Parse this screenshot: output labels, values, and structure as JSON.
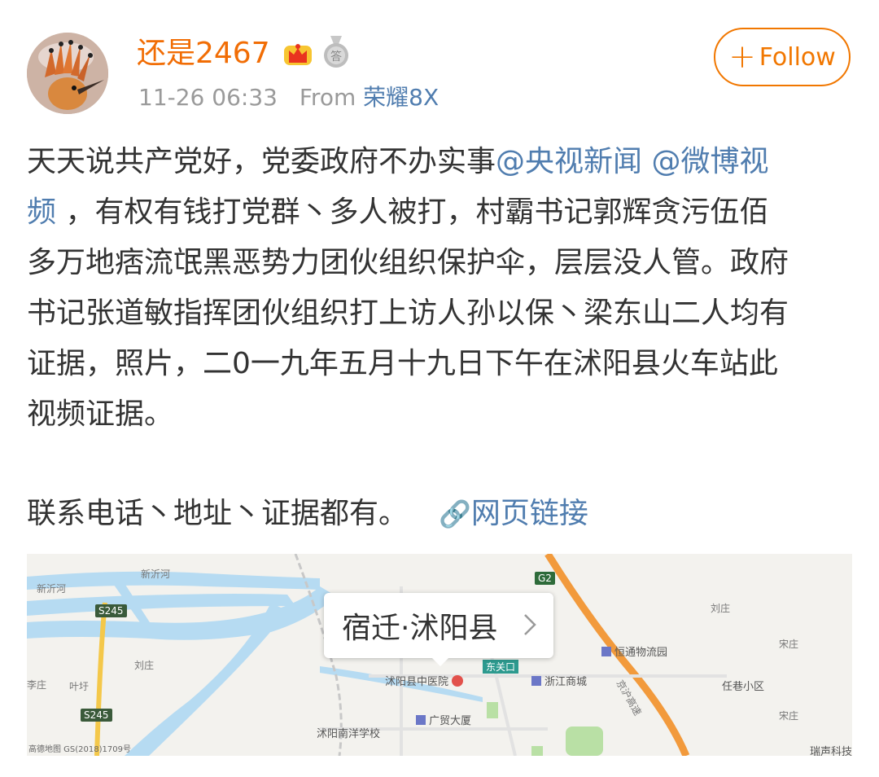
{
  "user": {
    "name": "还是2467",
    "timestamp": "11-26 06:33",
    "from_label": "From",
    "device": "荣耀8X"
  },
  "follow_button": {
    "plus": "+",
    "label": "Follow"
  },
  "post": {
    "text_part1": "天天说共产党好，党委政府不办实事",
    "mention1": "@央视新闻",
    "mention2_a": "@微博视",
    "mention2_b": "频",
    "text_line2": " ，有权有钱打党群丶多人被打，村霸书记郭辉贪污伍佰",
    "text_line3": "多万地痞流氓黑恶势力团伙组织保护伞，层层没人管。政府",
    "text_line4": "书记张道敏指挥团伙组织打上访人孙以保丶梁东山二人均有",
    "text_line5": "证据，照片，二0一九年五月十九日下午在沭阳县火车站此",
    "text_line6": "视频证据。",
    "contact_text": "联系电话丶地址丶证据都有。",
    "weblink_icon": "🔗",
    "weblink_label": "网页链接"
  },
  "map": {
    "location_card": "宿迁·沭阳县",
    "labels": {
      "xinyi_river_1": "新沂河",
      "xinyi_river_2": "新沂河",
      "s245_top": "S245",
      "s245_bottom": "S245",
      "g2": "G2",
      "liuzhuang_left": "刘庄",
      "liuzhuang_right": "刘庄",
      "yegou": "叶圩",
      "lizhuang": "李庄",
      "hospital": "沭阳县中医院",
      "dongguankou": "东关口",
      "zhejiang_mall": "浙江商城",
      "hengtong": "恒通物流园",
      "renxiang": "任巷小区",
      "songzhuang": "宋庄",
      "guangmao": "广贸大厦",
      "nanyang_school": "沭阳南洋学校",
      "songzhuang_lower": "宋庄",
      "ruisheng": "瑞声科技",
      "huaishu_highway": "京沪高速"
    },
    "footer": "高德地图 GS(2018)1709号"
  }
}
